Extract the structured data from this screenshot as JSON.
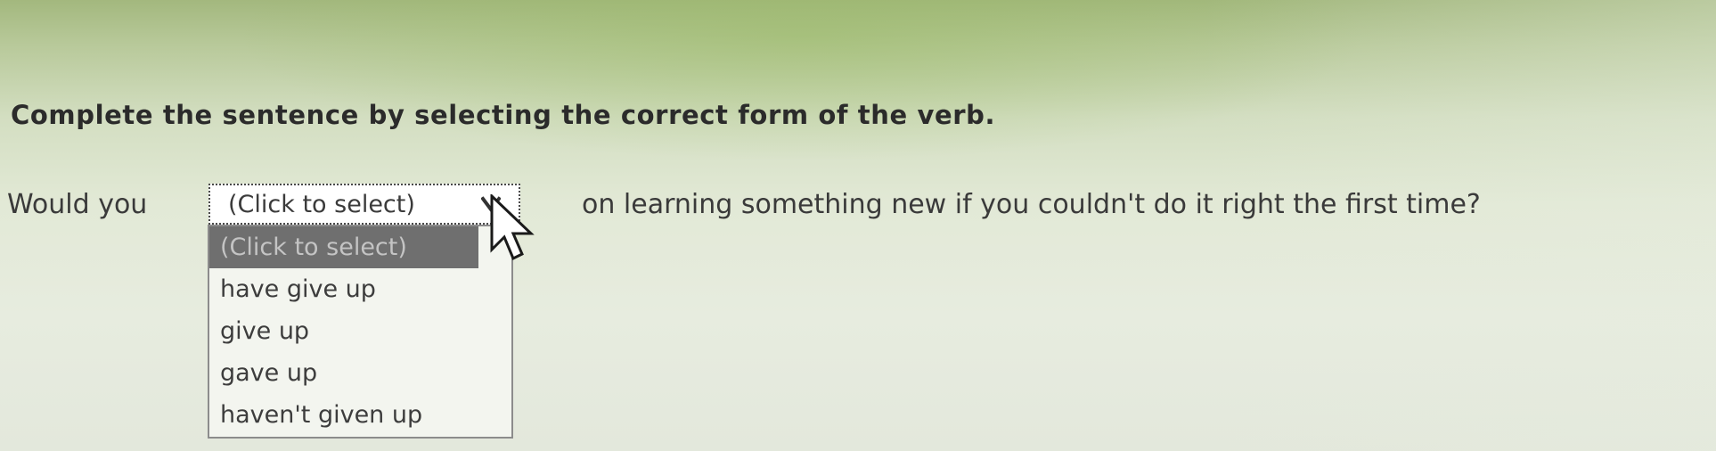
{
  "instruction": {
    "text": "Complete the sentence by selecting the correct form of the verb."
  },
  "sentence": {
    "prefix": "Would you",
    "suffix": "on learning something new if you couldn't do it right the first time?"
  },
  "select": {
    "value": "(Click to select)",
    "arrow_icon": "chevron-down-icon",
    "options": [
      "(Click to select)",
      "have give up",
      "give up",
      "gave up",
      "haven't given up"
    ],
    "highlighted_option": "(Click to select)"
  },
  "cursor": {
    "icon": "mouse-pointer-icon"
  },
  "colors": {
    "text": "#3a3a3a",
    "highlight_bg": "#6f6f6f",
    "highlight_text": "#c4c4c4",
    "dropdown_bg": "#f3f5ef",
    "background_top": "#a3b87e",
    "background_bottom": "#e3e8dc"
  }
}
